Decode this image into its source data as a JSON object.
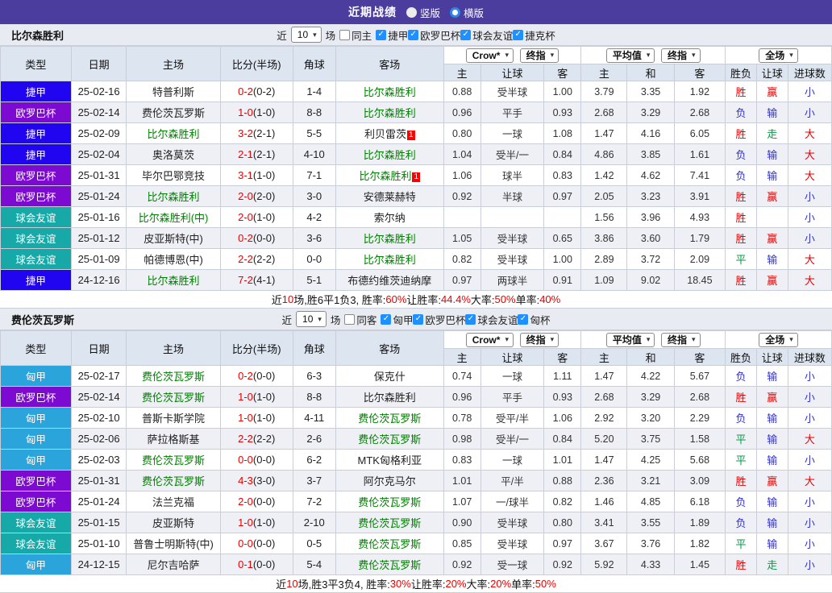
{
  "titlebar": {
    "title": "近期战绩",
    "radio_vertical": "竖版",
    "radio_horizontal": "横版",
    "selected": "横版"
  },
  "icons": {
    "check": "✓",
    "chevron_down": "▾"
  },
  "colors": {
    "titlebar_bg": "#4a3d9e",
    "team_green": "#008000",
    "score_red": "#e60000",
    "result_red": "#e60000",
    "result_blue": "#3333cc",
    "result_green": "#089944",
    "checkbox_blue": "#1e90ff",
    "radio_blue": "#2f86e8",
    "league_colors": {
      "捷甲": "#2205f0",
      "欧罗巴杯": "#7d0ad0",
      "球会友谊": "#17a8a8",
      "匈甲": "#2aa4da"
    }
  },
  "columns": {
    "type": "类型",
    "date": "日期",
    "home": "主场",
    "score": "比分(半场)",
    "corner": "角球",
    "away": "客场",
    "sub": [
      "主",
      "让球",
      "客",
      "主",
      "和",
      "客",
      "胜负",
      "让球",
      "进球数"
    ],
    "dd_crow": "Crow*",
    "dd_final1": "终指",
    "dd_avg": "平均值",
    "dd_final2": "终指",
    "dd_full": "全场"
  },
  "tables": [
    {
      "team": "比尔森胜利",
      "filter": {
        "near": "近",
        "count": "10",
        "games": "场",
        "same": "同主",
        "leagues": [
          "捷甲",
          "欧罗巴杯",
          "球会友谊",
          "捷克杯"
        ]
      },
      "rows": [
        {
          "type": "捷甲",
          "date": "25-02-16",
          "home": "特普利斯",
          "home_green": false,
          "score": "0-2",
          "half": "(0-2)",
          "corner": "1-4",
          "away": "比尔森胜利",
          "away_green": true,
          "away_sup": "",
          "crow": [
            "0.88",
            "受半球",
            "1.00"
          ],
          "avg": [
            "3.79",
            "3.35",
            "1.92"
          ],
          "res": [
            [
              "胜",
              "r"
            ],
            [
              "赢",
              "r"
            ],
            [
              "小",
              "b"
            ]
          ]
        },
        {
          "type": "欧罗巴杯",
          "date": "25-02-14",
          "home": "费伦茨瓦罗斯",
          "home_green": false,
          "score": "1-0",
          "half": "(1-0)",
          "corner": "8-8",
          "away": "比尔森胜利",
          "away_green": true,
          "away_sup": "",
          "crow": [
            "0.96",
            "平手",
            "0.93"
          ],
          "avg": [
            "2.68",
            "3.29",
            "2.68"
          ],
          "res": [
            [
              "负",
              "b"
            ],
            [
              "输",
              "b"
            ],
            [
              "小",
              "b"
            ]
          ]
        },
        {
          "type": "捷甲",
          "date": "25-02-09",
          "home": "比尔森胜利",
          "home_green": true,
          "score": "3-2",
          "half": "(2-1)",
          "corner": "5-5",
          "away": "利贝雷茨",
          "away_green": false,
          "away_sup": "1",
          "crow": [
            "0.80",
            "一球",
            "1.08"
          ],
          "avg": [
            "1.47",
            "4.16",
            "6.05"
          ],
          "res": [
            [
              "胜",
              "r"
            ],
            [
              "走",
              "g"
            ],
            [
              "大",
              "r"
            ]
          ]
        },
        {
          "type": "捷甲",
          "date": "25-02-04",
          "home": "奥洛莫茨",
          "home_green": false,
          "score": "2-1",
          "half": "(2-1)",
          "corner": "4-10",
          "away": "比尔森胜利",
          "away_green": true,
          "away_sup": "",
          "crow": [
            "1.04",
            "受半/一",
            "0.84"
          ],
          "avg": [
            "4.86",
            "3.85",
            "1.61"
          ],
          "res": [
            [
              "负",
              "b"
            ],
            [
              "输",
              "b"
            ],
            [
              "大",
              "r"
            ]
          ]
        },
        {
          "type": "欧罗巴杯",
          "date": "25-01-31",
          "home": "毕尔巴鄂竞技",
          "home_green": false,
          "score": "3-1",
          "half": "(1-0)",
          "corner": "7-1",
          "away": "比尔森胜利",
          "away_green": true,
          "away_sup": "1",
          "crow": [
            "1.06",
            "球半",
            "0.83"
          ],
          "avg": [
            "1.42",
            "4.62",
            "7.41"
          ],
          "res": [
            [
              "负",
              "b"
            ],
            [
              "输",
              "b"
            ],
            [
              "大",
              "r"
            ]
          ]
        },
        {
          "type": "欧罗巴杯",
          "date": "25-01-24",
          "home": "比尔森胜利",
          "home_green": true,
          "score": "2-0",
          "half": "(2-0)",
          "corner": "3-0",
          "away": "安德莱赫特",
          "away_green": false,
          "away_sup": "",
          "crow": [
            "0.92",
            "半球",
            "0.97"
          ],
          "avg": [
            "2.05",
            "3.23",
            "3.91"
          ],
          "res": [
            [
              "胜",
              "r"
            ],
            [
              "赢",
              "r"
            ],
            [
              "小",
              "b"
            ]
          ]
        },
        {
          "type": "球会友谊",
          "date": "25-01-16",
          "home": "比尔森胜利(中)",
          "home_green": true,
          "score": "2-0",
          "half": "(1-0)",
          "corner": "4-2",
          "away": "索尔纳",
          "away_green": false,
          "away_sup": "",
          "crow": [
            "",
            "",
            ""
          ],
          "avg": [
            "1.56",
            "3.96",
            "4.93"
          ],
          "res": [
            [
              "胜",
              "r"
            ],
            [
              "",
              "k"
            ],
            [
              "小",
              "b"
            ]
          ]
        },
        {
          "type": "球会友谊",
          "date": "25-01-12",
          "home": "皮亚斯特(中)",
          "home_green": false,
          "score": "0-2",
          "half": "(0-0)",
          "corner": "3-6",
          "away": "比尔森胜利",
          "away_green": true,
          "away_sup": "",
          "crow": [
            "1.05",
            "受半球",
            "0.65"
          ],
          "avg": [
            "3.86",
            "3.60",
            "1.79"
          ],
          "res": [
            [
              "胜",
              "r"
            ],
            [
              "赢",
              "r"
            ],
            [
              "小",
              "b"
            ]
          ]
        },
        {
          "type": "球会友谊",
          "date": "25-01-09",
          "home": "帕德博恩(中)",
          "home_green": false,
          "score": "2-2",
          "half": "(2-2)",
          "corner": "0-0",
          "away": "比尔森胜利",
          "away_green": true,
          "away_sup": "",
          "crow": [
            "0.82",
            "受半球",
            "1.00"
          ],
          "avg": [
            "2.89",
            "3.72",
            "2.09"
          ],
          "res": [
            [
              "平",
              "g"
            ],
            [
              "输",
              "b"
            ],
            [
              "大",
              "r"
            ]
          ]
        },
        {
          "type": "捷甲",
          "date": "24-12-16",
          "home": "比尔森胜利",
          "home_green": true,
          "score": "7-2",
          "half": "(4-1)",
          "corner": "5-1",
          "away": "布德约维茨迪纳摩",
          "away_green": false,
          "away_sup": "",
          "crow": [
            "0.97",
            "两球半",
            "0.91"
          ],
          "avg": [
            "1.09",
            "9.02",
            "18.45"
          ],
          "res": [
            [
              "胜",
              "r"
            ],
            [
              "赢",
              "r"
            ],
            [
              "大",
              "r"
            ]
          ]
        }
      ],
      "summary": [
        [
          "近",
          "k"
        ],
        [
          "10",
          "r"
        ],
        [
          "场,胜6平1负3, 胜率:",
          "k"
        ],
        [
          "60%",
          "r"
        ],
        [
          " 让胜率:",
          "k"
        ],
        [
          "44.4%",
          "r"
        ],
        [
          " 大率:",
          "k"
        ],
        [
          "50%",
          "r"
        ],
        [
          " 单率:",
          "k"
        ],
        [
          "40%",
          "r"
        ]
      ]
    },
    {
      "team": "费伦茨瓦罗斯",
      "filter": {
        "near": "近",
        "count": "10",
        "games": "场",
        "same": "同客",
        "leagues": [
          "匈甲",
          "欧罗巴杯",
          "球会友谊",
          "匈杯"
        ]
      },
      "rows": [
        {
          "type": "匈甲",
          "date": "25-02-17",
          "home": "费伦茨瓦罗斯",
          "home_green": true,
          "score": "0-2",
          "half": "(0-0)",
          "corner": "6-3",
          "away": "保克什",
          "away_green": false,
          "away_sup": "",
          "crow": [
            "0.74",
            "一球",
            "1.11"
          ],
          "avg": [
            "1.47",
            "4.22",
            "5.67"
          ],
          "res": [
            [
              "负",
              "b"
            ],
            [
              "输",
              "b"
            ],
            [
              "小",
              "b"
            ]
          ]
        },
        {
          "type": "欧罗巴杯",
          "date": "25-02-14",
          "home": "费伦茨瓦罗斯",
          "home_green": true,
          "score": "1-0",
          "half": "(1-0)",
          "corner": "8-8",
          "away": "比尔森胜利",
          "away_green": false,
          "away_sup": "",
          "crow": [
            "0.96",
            "平手",
            "0.93"
          ],
          "avg": [
            "2.68",
            "3.29",
            "2.68"
          ],
          "res": [
            [
              "胜",
              "r"
            ],
            [
              "赢",
              "r"
            ],
            [
              "小",
              "b"
            ]
          ]
        },
        {
          "type": "匈甲",
          "date": "25-02-10",
          "home": "普斯卡斯学院",
          "home_green": false,
          "score": "1-0",
          "half": "(1-0)",
          "corner": "4-11",
          "away": "费伦茨瓦罗斯",
          "away_green": true,
          "away_sup": "",
          "crow": [
            "0.78",
            "受平/半",
            "1.06"
          ],
          "avg": [
            "2.92",
            "3.20",
            "2.29"
          ],
          "res": [
            [
              "负",
              "b"
            ],
            [
              "输",
              "b"
            ],
            [
              "小",
              "b"
            ]
          ]
        },
        {
          "type": "匈甲",
          "date": "25-02-06",
          "home": "萨拉格斯基",
          "home_green": false,
          "score": "2-2",
          "half": "(2-2)",
          "corner": "2-6",
          "away": "费伦茨瓦罗斯",
          "away_green": true,
          "away_sup": "",
          "crow": [
            "0.98",
            "受半/一",
            "0.84"
          ],
          "avg": [
            "5.20",
            "3.75",
            "1.58"
          ],
          "res": [
            [
              "平",
              "g"
            ],
            [
              "输",
              "b"
            ],
            [
              "大",
              "r"
            ]
          ]
        },
        {
          "type": "匈甲",
          "date": "25-02-03",
          "home": "费伦茨瓦罗斯",
          "home_green": true,
          "score": "0-0",
          "half": "(0-0)",
          "corner": "6-2",
          "away": "MTK匈格利亚",
          "away_green": false,
          "away_sup": "",
          "crow": [
            "0.83",
            "一球",
            "1.01"
          ],
          "avg": [
            "1.47",
            "4.25",
            "5.68"
          ],
          "res": [
            [
              "平",
              "g"
            ],
            [
              "输",
              "b"
            ],
            [
              "小",
              "b"
            ]
          ]
        },
        {
          "type": "欧罗巴杯",
          "date": "25-01-31",
          "home": "费伦茨瓦罗斯",
          "home_green": true,
          "score": "4-3",
          "half": "(3-0)",
          "corner": "3-7",
          "away": "阿尔克马尔",
          "away_green": false,
          "away_sup": "",
          "crow": [
            "1.01",
            "平/半",
            "0.88"
          ],
          "avg": [
            "2.36",
            "3.21",
            "3.09"
          ],
          "res": [
            [
              "胜",
              "r"
            ],
            [
              "赢",
              "r"
            ],
            [
              "大",
              "r"
            ]
          ]
        },
        {
          "type": "欧罗巴杯",
          "date": "25-01-24",
          "home": "法兰克福",
          "home_green": false,
          "score": "2-0",
          "half": "(0-0)",
          "corner": "7-2",
          "away": "费伦茨瓦罗斯",
          "away_green": true,
          "away_sup": "",
          "crow": [
            "1.07",
            "一/球半",
            "0.82"
          ],
          "avg": [
            "1.46",
            "4.85",
            "6.18"
          ],
          "res": [
            [
              "负",
              "b"
            ],
            [
              "输",
              "b"
            ],
            [
              "小",
              "b"
            ]
          ]
        },
        {
          "type": "球会友谊",
          "date": "25-01-15",
          "home": "皮亚斯特",
          "home_green": false,
          "score": "1-0",
          "half": "(1-0)",
          "corner": "2-10",
          "away": "费伦茨瓦罗斯",
          "away_green": true,
          "away_sup": "",
          "crow": [
            "0.90",
            "受半球",
            "0.80"
          ],
          "avg": [
            "3.41",
            "3.55",
            "1.89"
          ],
          "res": [
            [
              "负",
              "b"
            ],
            [
              "输",
              "b"
            ],
            [
              "小",
              "b"
            ]
          ]
        },
        {
          "type": "球会友谊",
          "date": "25-01-10",
          "home": "普鲁士明斯特(中)",
          "home_green": false,
          "score": "0-0",
          "half": "(0-0)",
          "corner": "0-5",
          "away": "费伦茨瓦罗斯",
          "away_green": true,
          "away_sup": "",
          "crow": [
            "0.85",
            "受半球",
            "0.97"
          ],
          "avg": [
            "3.67",
            "3.76",
            "1.82"
          ],
          "res": [
            [
              "平",
              "g"
            ],
            [
              "输",
              "b"
            ],
            [
              "小",
              "b"
            ]
          ]
        },
        {
          "type": "匈甲",
          "date": "24-12-15",
          "home": "尼尔吉哈萨",
          "home_green": false,
          "score": "0-1",
          "half": "(0-0)",
          "corner": "5-4",
          "away": "费伦茨瓦罗斯",
          "away_green": true,
          "away_sup": "",
          "crow": [
            "0.92",
            "受一球",
            "0.92"
          ],
          "avg": [
            "5.92",
            "4.33",
            "1.45"
          ],
          "res": [
            [
              "胜",
              "r"
            ],
            [
              "走",
              "g"
            ],
            [
              "小",
              "b"
            ]
          ]
        }
      ],
      "summary": [
        [
          "近",
          "k"
        ],
        [
          "10",
          "r"
        ],
        [
          "场,胜3平3负4, 胜率:",
          "k"
        ],
        [
          "30%",
          "r"
        ],
        [
          " 让胜率:",
          "k"
        ],
        [
          "20%",
          "r"
        ],
        [
          " 大率:",
          "k"
        ],
        [
          "20%",
          "r"
        ],
        [
          " 单率:",
          "k"
        ],
        [
          "50%",
          "r"
        ]
      ]
    }
  ]
}
